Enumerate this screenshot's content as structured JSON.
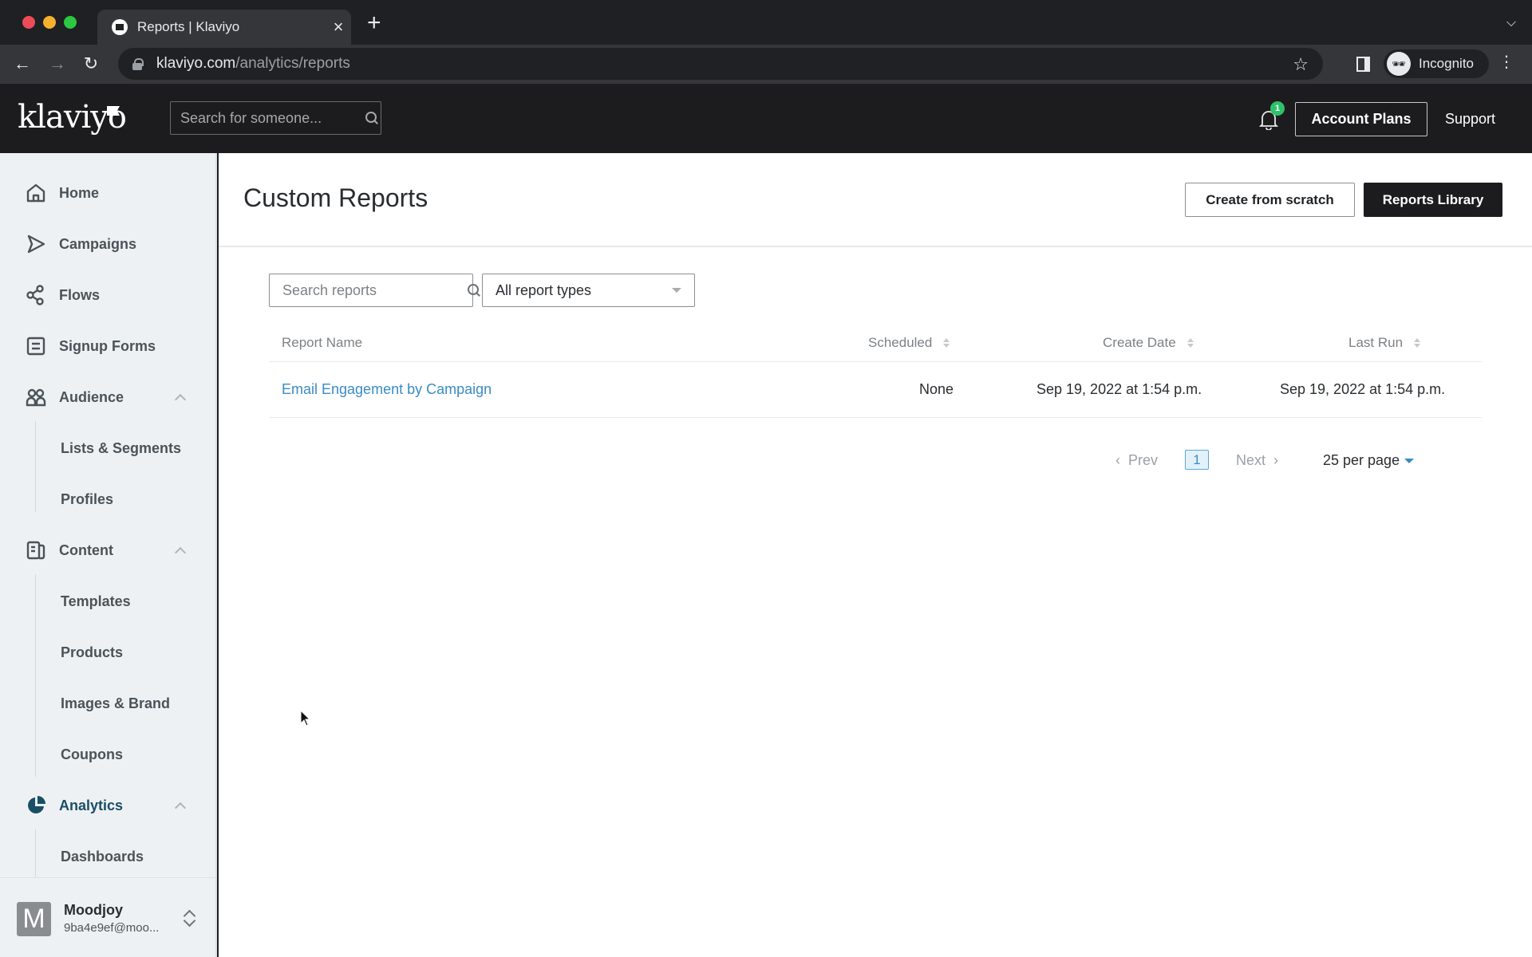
{
  "browser": {
    "tab_title": "Reports | Klaviyo",
    "url_host": "klaviyo.com",
    "url_path": "/analytics/reports",
    "profile_label": "Incognito"
  },
  "header": {
    "logo_text": "klaviyo",
    "search_placeholder": "Search for someone...",
    "notification_count": "1",
    "account_plans_label": "Account Plans",
    "support_label": "Support"
  },
  "sidebar": {
    "items": [
      {
        "label": "Home",
        "icon": "home-icon"
      },
      {
        "label": "Campaigns",
        "icon": "send-icon"
      },
      {
        "label": "Flows",
        "icon": "flows-icon"
      },
      {
        "label": "Signup Forms",
        "icon": "form-icon"
      },
      {
        "label": "Audience",
        "icon": "people-icon",
        "expanded": true,
        "children": [
          "Lists & Segments",
          "Profiles"
        ]
      },
      {
        "label": "Content",
        "icon": "content-icon",
        "expanded": true,
        "children": [
          "Templates",
          "Products",
          "Images & Brand",
          "Coupons"
        ]
      },
      {
        "label": "Analytics",
        "icon": "pie-chart-icon",
        "expanded": true,
        "active": true,
        "children": [
          "Dashboards"
        ]
      }
    ],
    "account": {
      "avatar_letter": "M",
      "name": "Moodjoy",
      "email": "9ba4e9ef@moo..."
    }
  },
  "page": {
    "title": "Custom Reports",
    "create_button": "Create from scratch",
    "library_button": "Reports Library",
    "search_placeholder": "Search reports",
    "type_filter_value": "All report types",
    "accent_color": "#3a8cc1"
  },
  "table": {
    "columns": [
      "Report Name",
      "Scheduled",
      "Create Date",
      "Last Run"
    ],
    "rows": [
      {
        "name": "Email Engagement by Campaign",
        "scheduled": "None",
        "create_date": "Sep 19, 2022 at 1:54 p.m.",
        "last_run": "Sep 19, 2022 at 1:54 p.m."
      }
    ]
  },
  "pagination": {
    "prev_label": "Prev",
    "current_page": "1",
    "next_label": "Next",
    "per_page_label": "25 per page"
  }
}
